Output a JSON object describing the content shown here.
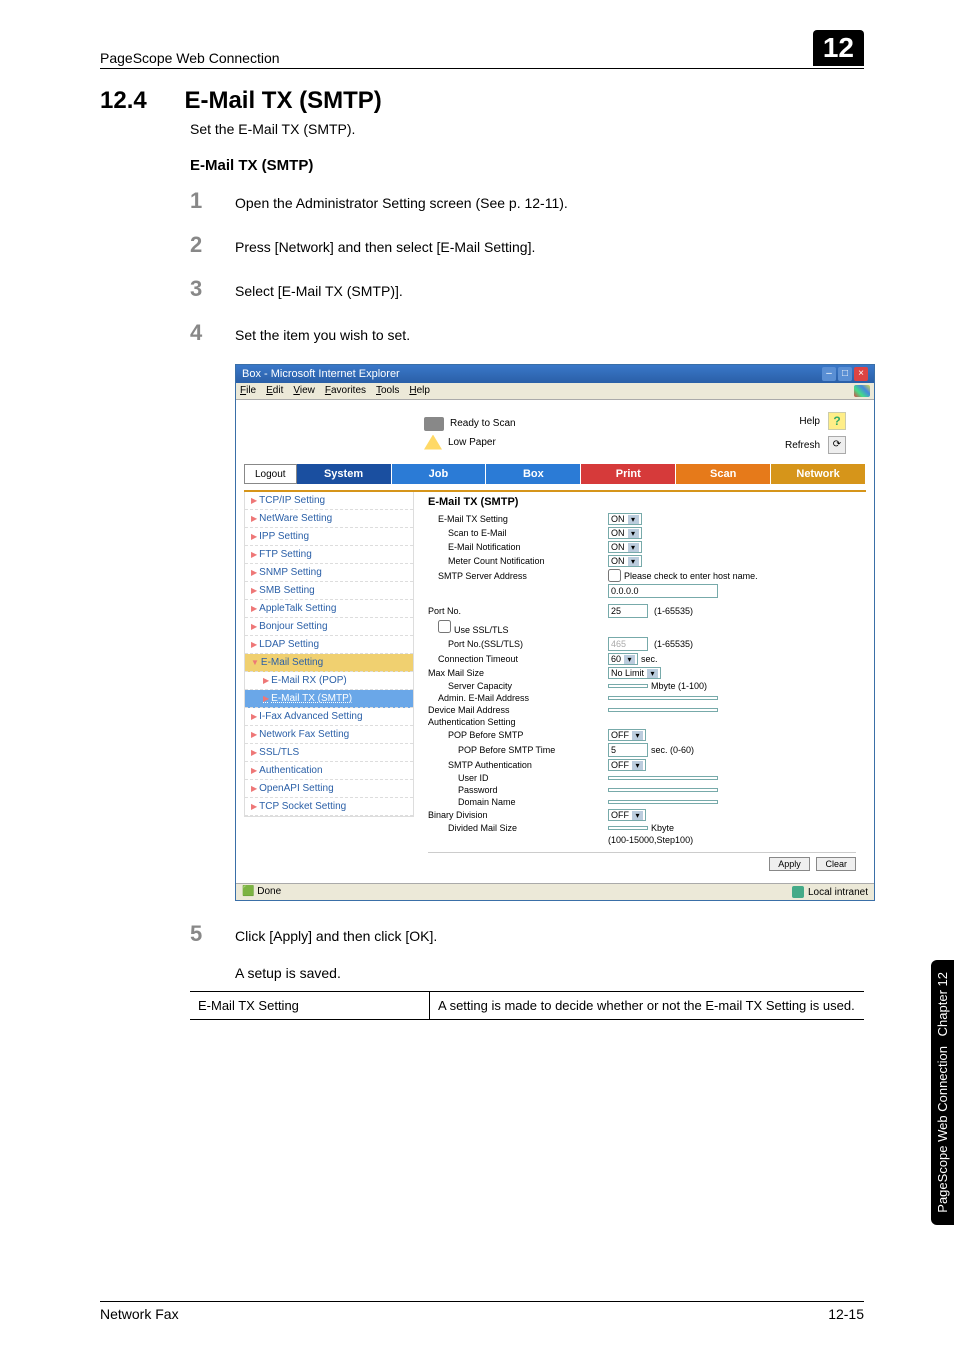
{
  "page": {
    "header_title": "PageScope Web Connection",
    "header_num": "12",
    "section_num": "12.4",
    "section_title": "E-Mail TX (SMTP)",
    "intro": "Set the E-Mail TX (SMTP).",
    "subheading": "E-Mail TX (SMTP)",
    "steps": {
      "s1": {
        "n": "1",
        "t": "Open the Administrator Setting screen (See p. 12-11)."
      },
      "s2": {
        "n": "2",
        "t": "Press [Network] and then select [E-Mail Setting]."
      },
      "s3": {
        "n": "3",
        "t": "Select [E-Mail TX (SMTP)]."
      },
      "s4": {
        "n": "4",
        "t": "Set the item you wish to set."
      },
      "s5": {
        "n": "5",
        "t": "Click [Apply] and then click [OK]."
      },
      "s5b": "A setup is saved."
    },
    "spec": {
      "label": "E-Mail TX Setting",
      "desc": "A setting is made to decide whether or not the E-mail TX Setting is used."
    },
    "footer_left": "Network Fax",
    "footer_right": "12-15",
    "side_tab_top": "Chapter 12",
    "side_tab_bottom": "PageScope Web Connection"
  },
  "browser": {
    "title": "Box - Microsoft Internet Explorer",
    "menus": [
      "File",
      "Edit",
      "View",
      "Favorites",
      "Tools",
      "Help"
    ],
    "status": {
      "ready": "Ready to Scan",
      "low": "Low Paper",
      "help": "Help",
      "refresh": "Refresh",
      "q": "?",
      "r": "⟳"
    },
    "logout": "Logout",
    "tabs": {
      "system": "System",
      "job": "Job",
      "box": "Box",
      "print": "Print",
      "scan": "Scan",
      "network": "Network"
    },
    "sidebar": [
      "TCP/IP Setting",
      "NetWare Setting",
      "IPP Setting",
      "FTP Setting",
      "SNMP Setting",
      "SMB Setting",
      "AppleTalk Setting",
      "Bonjour Setting",
      "LDAP Setting"
    ],
    "sidebar_expanded": "E-Mail Setting",
    "sidebar_sub": [
      "E-Mail RX (POP)",
      "E-Mail TX (SMTP)"
    ],
    "sidebar_rest": [
      "I-Fax Advanced Setting",
      "Network Fax Setting",
      "SSL/TLS",
      "Authentication",
      "OpenAPI Setting",
      "TCP Socket Setting"
    ],
    "form": {
      "title": "E-Mail TX (SMTP)",
      "email_tx_setting": {
        "label": "E-Mail TX Setting",
        "val": "ON"
      },
      "scan_to_email": {
        "label": "Scan to E-Mail",
        "val": "ON"
      },
      "email_notif": {
        "label": "E-Mail Notification",
        "val": "ON"
      },
      "meter_notif": {
        "label": "Meter Count Notification",
        "val": "ON"
      },
      "smtp_addr": {
        "label": "SMTP Server Address",
        "chk": "Please check to enter host name.",
        "val": "0.0.0.0"
      },
      "port_no": {
        "label": "Port No.",
        "val": "25",
        "range": "(1-65535)"
      },
      "use_ssl": {
        "label": "Use SSL/TLS"
      },
      "port_ssl": {
        "label": "Port No.(SSL/TLS)",
        "val": "465",
        "range": "(1-65535)"
      },
      "conn_to": {
        "label": "Connection Timeout",
        "val": "60",
        "unit": "sec."
      },
      "max_mail": {
        "label": "Max Mail Size",
        "val": "No Limit"
      },
      "server_cap": {
        "label": "Server Capacity",
        "unit": "Mbyte (1-100)"
      },
      "admin_addr": {
        "label": "Admin. E-Mail Address"
      },
      "dev_addr": {
        "label": "Device Mail Address"
      },
      "auth_setting": {
        "label": "Authentication Setting"
      },
      "pop_before": {
        "label": "POP Before SMTP",
        "val": "OFF"
      },
      "pop_time": {
        "label": "POP Before SMTP Time",
        "val": "5",
        "unit": "sec. (0-60)"
      },
      "smtp_auth": {
        "label": "SMTP Authentication",
        "val": "OFF"
      },
      "user_id": {
        "label": "User ID"
      },
      "password": {
        "label": "Password"
      },
      "domain": {
        "label": "Domain Name"
      },
      "bin_div": {
        "label": "Binary Division",
        "val": "OFF"
      },
      "div_size": {
        "label": "Divided Mail Size",
        "unit": "Kbyte",
        "range": "(100-15000,Step100)"
      },
      "apply": "Apply",
      "clear": "Clear"
    },
    "statusbar": {
      "done": "Done",
      "intranet": "Local intranet"
    }
  }
}
